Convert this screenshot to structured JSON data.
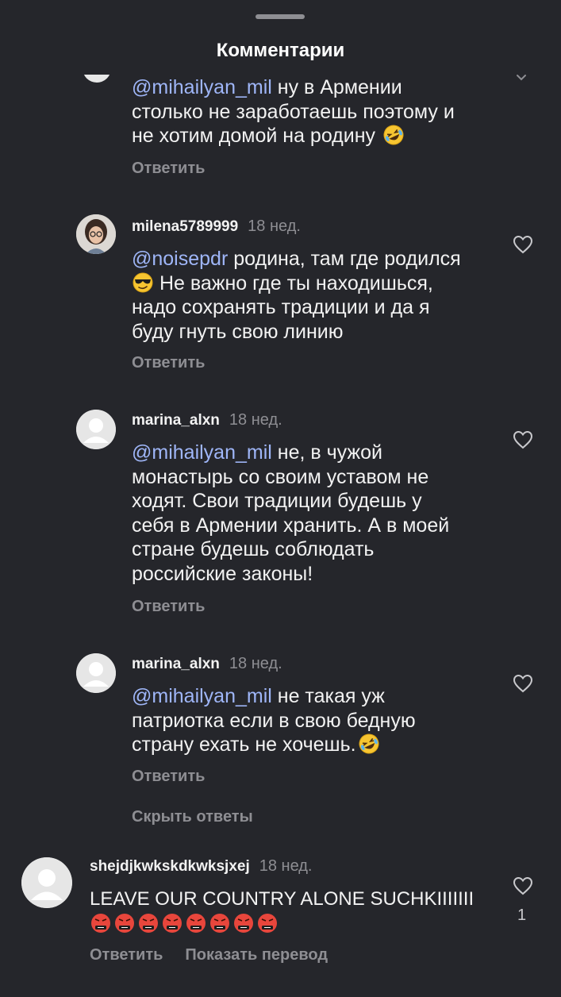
{
  "header": {
    "title": "Комментарии"
  },
  "comments": [
    {
      "mention": "@mihailyan_mil",
      "text_lines": [
        " ну в Армении",
        "столько не заработаешь поэтому и",
        "не хотим домой на родину"
      ],
      "reply_label": "Ответить",
      "emoji": "rofl-emoji"
    },
    {
      "username": "milena5789999",
      "time": "18 нед.",
      "mention": "@noisepdr",
      "text_lines": [
        " родина, там где родился",
        " Не важно где ты находишься,",
        "надо сохранять традиции и да я",
        "буду гнуть свою линию"
      ],
      "reply_label": "Ответить",
      "emoji": "sunglasses-emoji"
    },
    {
      "username": "marina_alxn",
      "time": "18 нед.",
      "mention": "@mihailyan_mil",
      "text_lines": [
        " не, в чужой",
        "монастырь со своим уставом не",
        "ходят. Свои традиции будешь у",
        "себя в Армении хранить. А в моей",
        "стране будешь соблюдать",
        "российские законы!"
      ],
      "reply_label": "Ответить"
    },
    {
      "username": "marina_alxn",
      "time": "18 нед.",
      "mention": "@mihailyan_mil",
      "text_lines": [
        " не такая уж",
        "патриотка если в свою бедную",
        "страну ехать не хочешь."
      ],
      "reply_label": "Ответить",
      "emoji": "rofl-emoji"
    },
    {
      "username": "shejdjkwkskdkwksjxej",
      "time": "18 нед.",
      "text_lines": [
        "LEAVE OUR COUNTRY ALONE SUCHKIIIIIII"
      ],
      "emoji_row": [
        "cursing-emoji",
        "cursing-emoji",
        "cursing-emoji",
        "cursing-emoji",
        "cursing-emoji",
        "cursing-emoji",
        "cursing-emoji",
        "cursing-emoji"
      ],
      "reply_label": "Ответить",
      "translate_label": "Показать перевод",
      "like_count": "1"
    }
  ],
  "hide_replies_label": "Скрыть ответы",
  "colors": {
    "background": "#25262b",
    "mention": "#9fb6f8",
    "muted": "#8e8e93"
  }
}
